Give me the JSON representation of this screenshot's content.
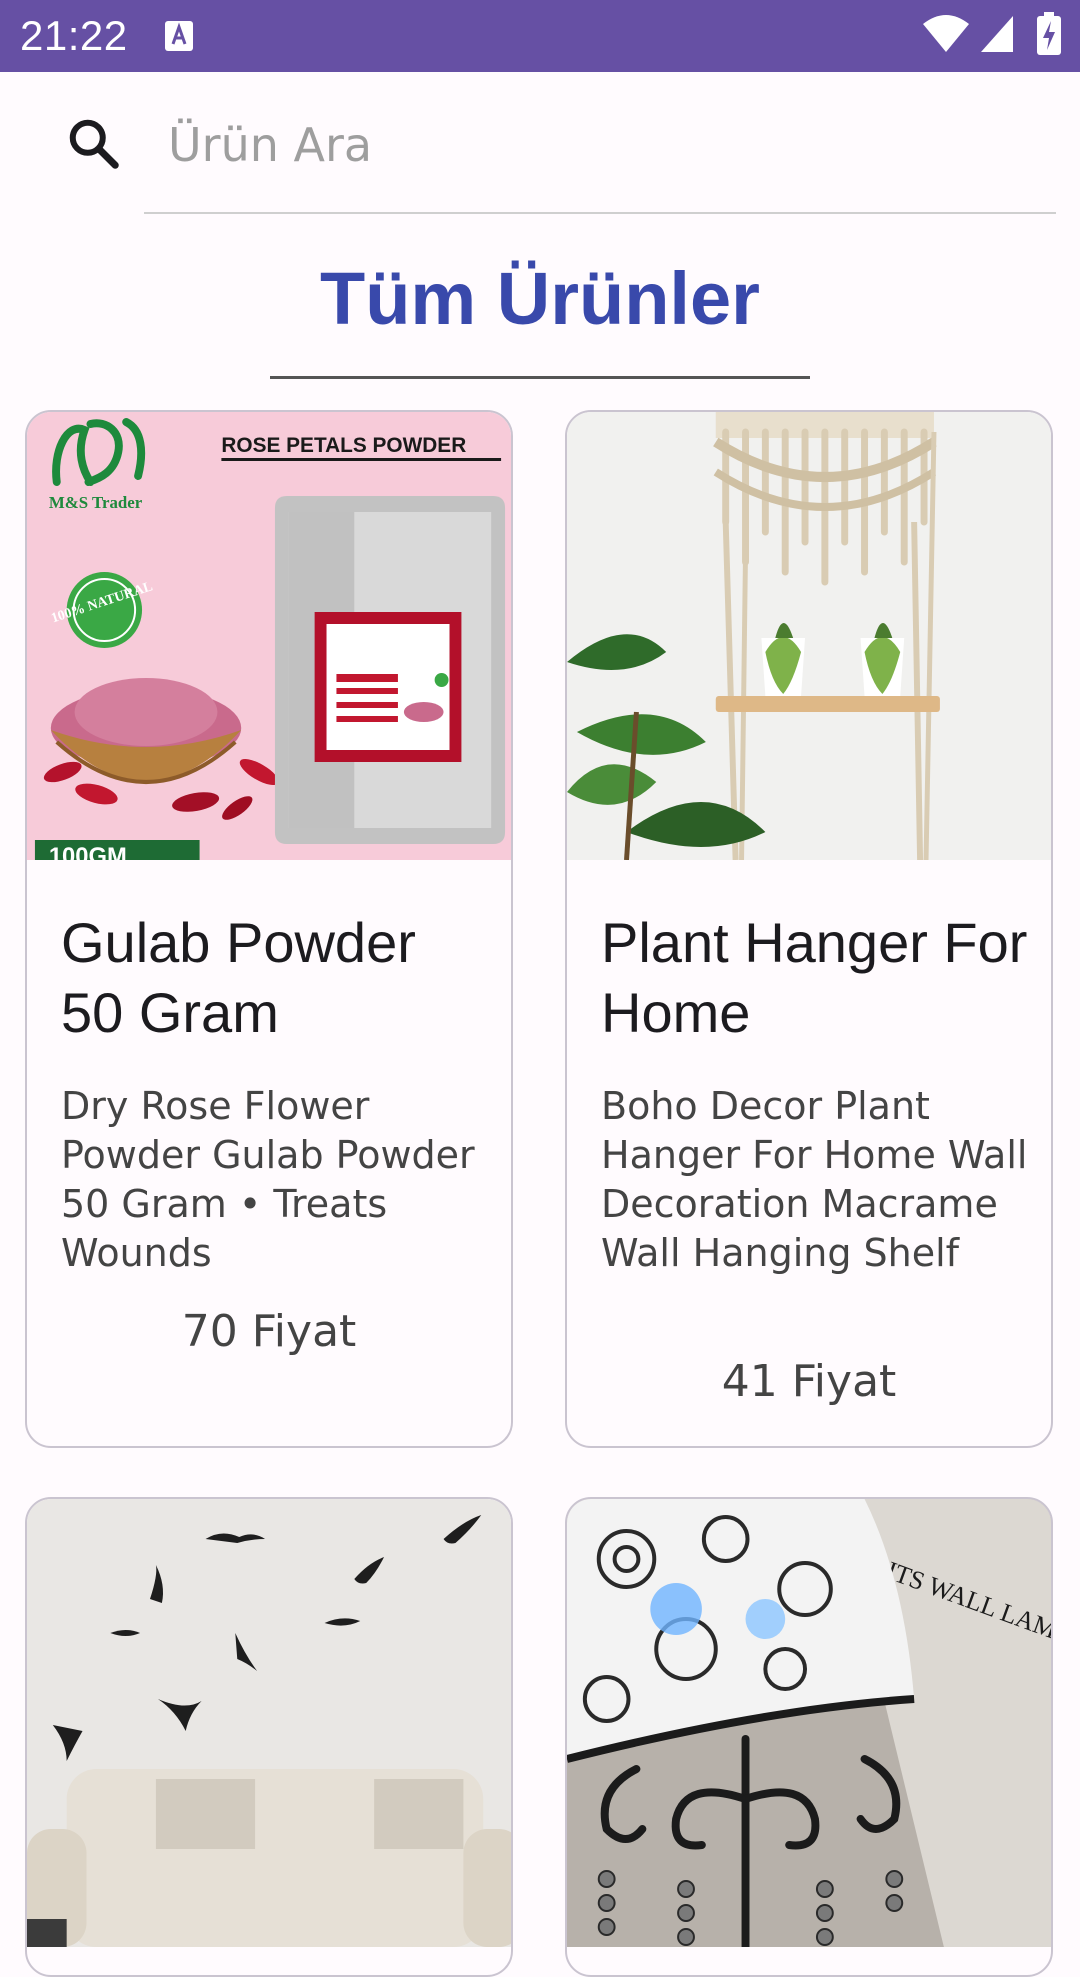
{
  "status_bar": {
    "time": "21:22",
    "background": "#6650a4",
    "icons": [
      "keyboard-a-icon",
      "wifi-icon",
      "signal-icon",
      "battery-charging-icon"
    ]
  },
  "search": {
    "placeholder": "Ürün Ara",
    "value": ""
  },
  "page": {
    "title": "Tüm Ürünler",
    "accent": "#3949ab"
  },
  "products": [
    {
      "title": "Gulab Powder 50 Gram",
      "description": "Dry Rose Flower Powder Gulab Powder 50 Gram • Treats Wounds",
      "price": "70 Fiyat",
      "image": {
        "brand": "M&S Trader",
        "heading": "ROSE PETALS POWDER",
        "badge": "100% NATURAL",
        "weight": "100GM"
      }
    },
    {
      "title": "Plant Hanger For Home",
      "description": "Boho Decor Plant Hanger For Home Wall Decoration Macrame Wall Hanging Shelf",
      "price": "41 Fiyat",
      "image": {}
    },
    {
      "title": "",
      "description": "",
      "price": "",
      "image": {}
    },
    {
      "title": "",
      "description": "",
      "price": "",
      "image": {
        "text": "LIGHTS WALL LAMP"
      }
    }
  ]
}
